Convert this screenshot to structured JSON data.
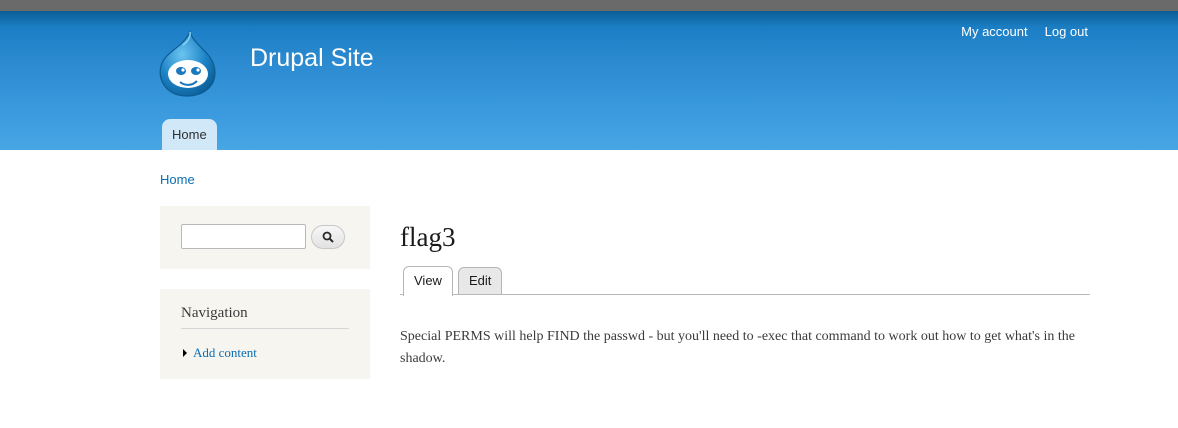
{
  "header": {
    "site_name": "Drupal Site",
    "logo_icon": "drupal-drop-icon",
    "secondary_menu": [
      "My account",
      "Log out"
    ],
    "main_menu": [
      "Home"
    ]
  },
  "breadcrumb": [
    "Home"
  ],
  "sidebar": {
    "search": {
      "input_value": "",
      "button_icon": "search-icon"
    },
    "navigation": {
      "title": "Navigation",
      "items": [
        "Add content"
      ]
    }
  },
  "content": {
    "title": "flag3",
    "tabs": [
      "View",
      "Edit"
    ],
    "active_tab": "View",
    "body": "Special PERMS will help FIND the passwd - but you'll need to -exec that command to work out how to get what's in the shadow."
  },
  "colors": {
    "header_blue": "#2b8ad0",
    "link": "#0a6eb4",
    "sidebar_bg": "#f6f5f0"
  }
}
